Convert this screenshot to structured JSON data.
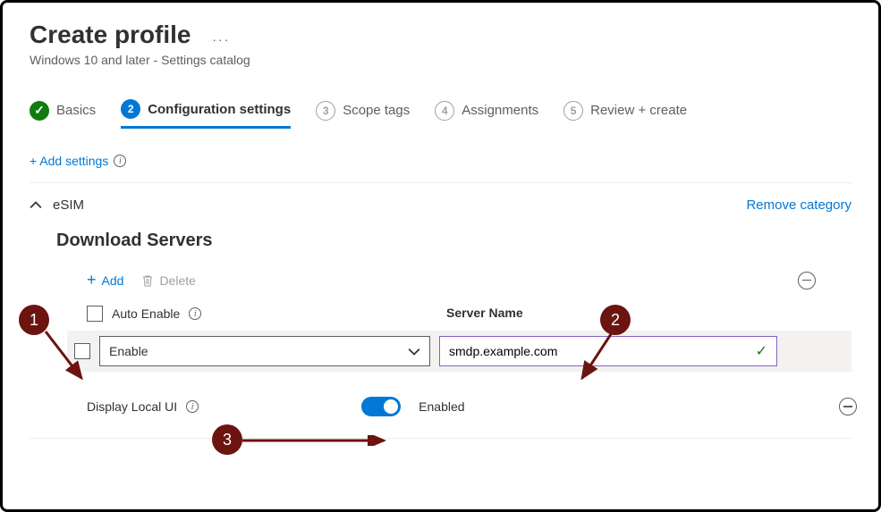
{
  "header": {
    "title": "Create profile",
    "subtitle": "Windows 10 and later - Settings catalog"
  },
  "steps": [
    {
      "num": "✓",
      "label": "Basics",
      "state": "done"
    },
    {
      "num": "2",
      "label": "Configuration settings",
      "state": "active"
    },
    {
      "num": "3",
      "label": "Scope tags",
      "state": "pending"
    },
    {
      "num": "4",
      "label": "Assignments",
      "state": "pending"
    },
    {
      "num": "5",
      "label": "Review + create",
      "state": "pending"
    }
  ],
  "add_settings_label": "+ Add settings",
  "category": {
    "name": "eSIM",
    "remove_label": "Remove category",
    "section_title": "Download Servers",
    "toolbar": {
      "add_label": "Add",
      "delete_label": "Delete"
    },
    "columns": {
      "auto_enable": "Auto Enable",
      "server_name": "Server Name"
    },
    "row": {
      "dropdown_value": "Enable",
      "server_value": "smdp.example.com"
    },
    "local_ui": {
      "label": "Display Local UI",
      "toggle_label": "Enabled"
    }
  },
  "annotations": {
    "a1": "1",
    "a2": "2",
    "a3": "3"
  }
}
